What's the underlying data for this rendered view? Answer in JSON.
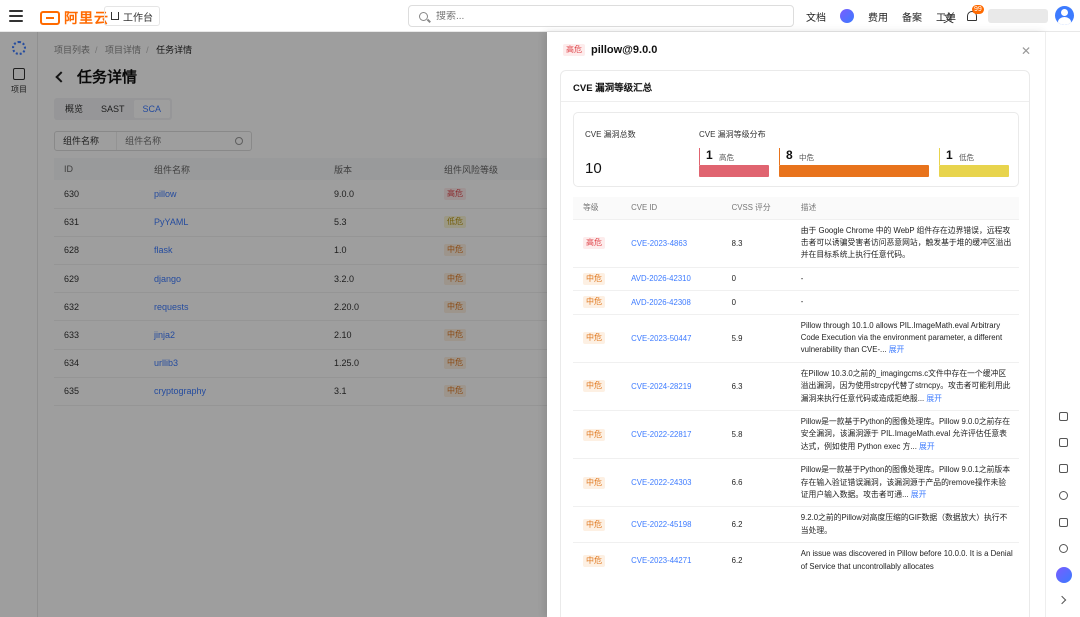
{
  "nav": {
    "brand": "阿里云",
    "workbench": "工作台",
    "search_placeholder": "搜索...",
    "links": [
      "文档",
      "费用",
      "备案",
      "工单"
    ],
    "notif_count": "99"
  },
  "left_rail": {
    "project_label": "项目"
  },
  "page": {
    "breadcrumb": [
      "项目列表",
      "项目详情",
      "任务详情"
    ],
    "title": "任务详情",
    "tabs": [
      "概览",
      "SAST",
      "SCA"
    ],
    "filter": {
      "select_label": "组件名称",
      "placeholder": "组件名称"
    },
    "table": {
      "headers": [
        "ID",
        "组件名称",
        "版本",
        "组件风险等级"
      ],
      "rows": [
        [
          "630",
          "pillow",
          "9.0.0",
          "高危"
        ],
        [
          "631",
          "PyYAML",
          "5.3",
          "低危"
        ],
        [
          "628",
          "flask",
          "1.0",
          "中危"
        ],
        [
          "629",
          "django",
          "3.2.0",
          "中危"
        ],
        [
          "632",
          "requests",
          "2.20.0",
          "中危"
        ],
        [
          "633",
          "jinja2",
          "2.10",
          "中危"
        ],
        [
          "634",
          "urllib3",
          "1.25.0",
          "中危"
        ],
        [
          "635",
          "cryptography",
          "3.1",
          "中危"
        ]
      ]
    }
  },
  "drawer": {
    "badge": "高危",
    "title": "pillow@9.0.0",
    "section_title": "CVE 漏洞等级汇总",
    "summary": {
      "total_label": "CVE 漏洞总数",
      "total": "10",
      "dist_label": "CVE 漏洞等级分布",
      "levels": [
        {
          "count": "1",
          "name": "高危",
          "color": "#e06470"
        },
        {
          "count": "8",
          "name": "中危",
          "color": "#e8731c"
        },
        {
          "count": "1",
          "name": "低危",
          "color": "#e8d44d"
        }
      ]
    },
    "cve_table": {
      "headers": [
        "等级",
        "CVE ID",
        "CVSS 评分",
        "描述"
      ],
      "rows": [
        {
          "level": "高危",
          "id": "CVE-2023-4863",
          "score": "8.3",
          "desc": "由于 Google Chrome 中的 WebP 组件存在边界错误，远程攻击者可以诱骗受害者访问恶意网站，触发基于堆的缓冲区溢出并在目标系统上执行任意代码。",
          "more": ""
        },
        {
          "level": "中危",
          "id": "AVD-2026-42310",
          "score": "0",
          "desc": "-",
          "more": ""
        },
        {
          "level": "中危",
          "id": "AVD-2026-42308",
          "score": "0",
          "desc": "-",
          "more": ""
        },
        {
          "level": "中危",
          "id": "CVE-2023-50447",
          "score": "5.9",
          "desc": "Pillow through 10.1.0 allows PIL.ImageMath.eval Arbitrary Code Execution via the environment parameter, a different vulnerability than CVE-...",
          "more": "展开"
        },
        {
          "level": "中危",
          "id": "CVE-2024-28219",
          "score": "6.3",
          "desc": "在Pillow 10.3.0之前的_imagingcms.c文件中存在一个缓冲区溢出漏洞，因为使用strcpy代替了strncpy。攻击者可能利用此漏洞来执行任意代码或造成拒绝服...",
          "more": "展开"
        },
        {
          "level": "中危",
          "id": "CVE-2022-22817",
          "score": "5.8",
          "desc": "Pillow是一款基于Python的图像处理库。Pillow 9.0.0之前存在安全漏洞，该漏洞源于 PIL.ImageMath.eval 允许评估任意表达式，例如使用 Python exec 方...",
          "more": "展开"
        },
        {
          "level": "中危",
          "id": "CVE-2022-24303",
          "score": "6.6",
          "desc": "Pillow是一款基于Python的图像处理库。Pillow 9.0.1之前版本存在输入验证错误漏洞，该漏洞源于产品的remove操作未验证用户输入数据。攻击者可通...",
          "more": "展开"
        },
        {
          "level": "中危",
          "id": "CVE-2022-45198",
          "score": "6.2",
          "desc": "9.2.0之前的Pillow对高度压缩的GIF数据（数据放大）执行不当处理。",
          "more": ""
        },
        {
          "level": "中危",
          "id": "CVE-2023-44271",
          "score": "6.2",
          "desc": "An issue was discovered in Pillow before 10.0.0. It is a Denial of Service that uncontrollably allocates",
          "more": ""
        }
      ]
    }
  },
  "colors": {
    "accent": "#3d7bff",
    "brand": "#ff6a00",
    "high": "#e0454a",
    "mid": "#e0781f",
    "low": "#b8960a"
  }
}
